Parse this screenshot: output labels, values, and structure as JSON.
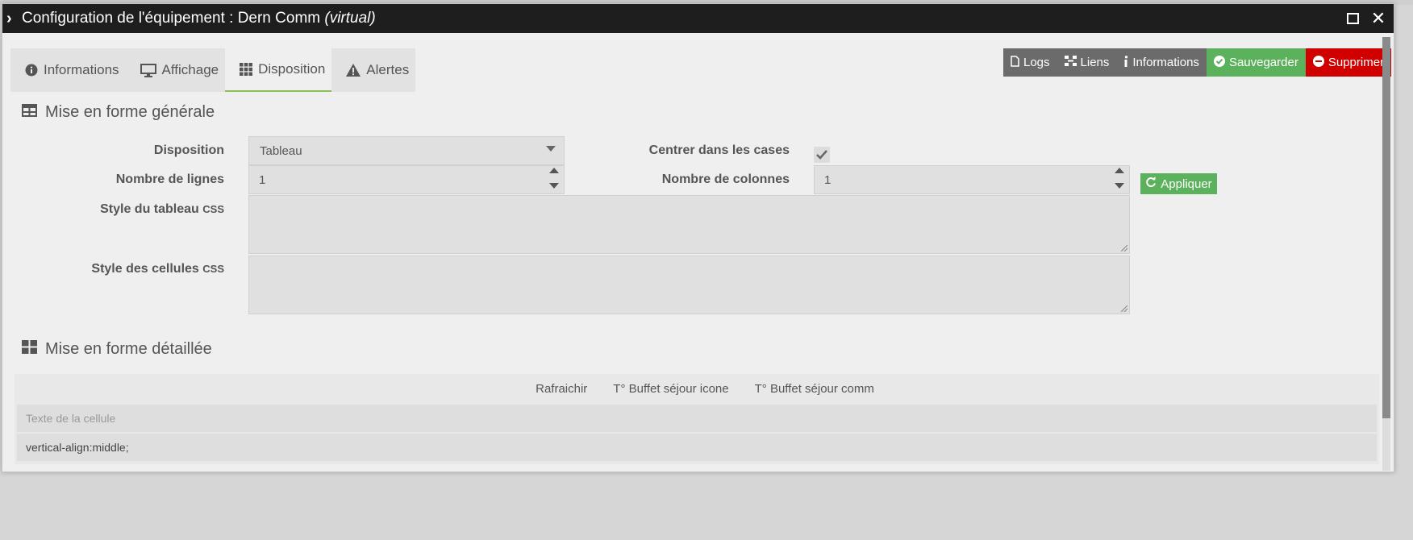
{
  "window": {
    "title": "Configuration de l'équipement : Dern Comm",
    "title_suffix": "(virtual)"
  },
  "tabs": [
    {
      "label": "Informations",
      "icon": "info-circle-icon"
    },
    {
      "label": "Affichage",
      "icon": "monitor-icon"
    },
    {
      "label": "Disposition",
      "icon": "grid-icon",
      "active": true
    },
    {
      "label": "Alertes",
      "icon": "warning-icon"
    }
  ],
  "actions": {
    "logs": "Logs",
    "liens": "Liens",
    "informations": "Informations",
    "sauvegarder": "Sauvegarder",
    "supprimer": "Supprimer"
  },
  "general": {
    "title": "Mise en forme générale",
    "disposition_label": "Disposition",
    "disposition_value": "Tableau",
    "centrer_label": "Centrer dans les cases",
    "centrer_checked": true,
    "lignes_label": "Nombre de lignes",
    "lignes_value": "1",
    "colonnes_label": "Nombre de colonnes",
    "colonnes_value": "1",
    "appliquer": "Appliquer",
    "style_tableau_label": "Style du tableau",
    "style_cellules_label": "Style des cellules",
    "css_tag": "CSS"
  },
  "detailed": {
    "title": "Mise en forme détaillée",
    "commands": [
      "Rafraichir",
      "T° Buffet séjour icone",
      "T° Buffet séjour comm"
    ],
    "cell_text_placeholder": "Texte de la cellule",
    "cell_style_value": "vertical-align:middle;"
  },
  "colors": {
    "titlebar": "#1e1e1e",
    "green": "#5cb15c",
    "red": "#d00000",
    "dark_button": "#6b6b6b",
    "tab_active_underline": "#8cc056"
  }
}
